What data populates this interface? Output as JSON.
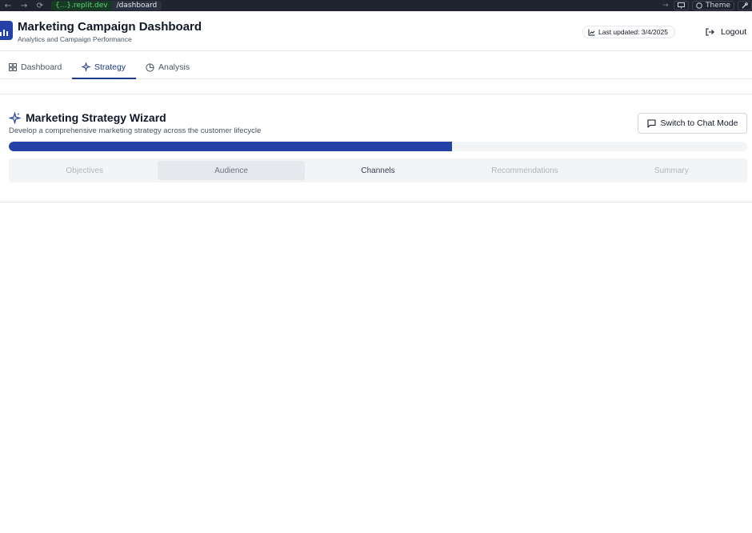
{
  "browser": {
    "host": "{...}.replit.dev",
    "path": "/dashboard",
    "theme_label": "Theme"
  },
  "header": {
    "title": "Marketing Campaign Dashboard",
    "subtitle": "Analytics and Campaign Performance",
    "last_updated": "Last updated: 3/4/2025",
    "logout_label": "Logout"
  },
  "tabs": [
    {
      "label": "Dashboard",
      "icon": "grid-icon",
      "active": false
    },
    {
      "label": "Strategy",
      "icon": "sparkles-icon",
      "active": true
    },
    {
      "label": "Analysis",
      "icon": "pie-chart-icon",
      "active": false
    }
  ],
  "wizard": {
    "title": "Marketing Strategy Wizard",
    "description": "Develop a comprehensive marketing strategy across the customer lifecycle",
    "chat_button_label": "Switch to Chat Mode",
    "progress": 0.6,
    "steps": [
      "Objectives",
      "Audience",
      "Channels",
      "Recommendations",
      "Summary"
    ],
    "current_step": "Audience"
  },
  "colors": {
    "brand": "#2541a8",
    "active_tab": "#1e3a8a",
    "url_host": "#5fd37a"
  }
}
